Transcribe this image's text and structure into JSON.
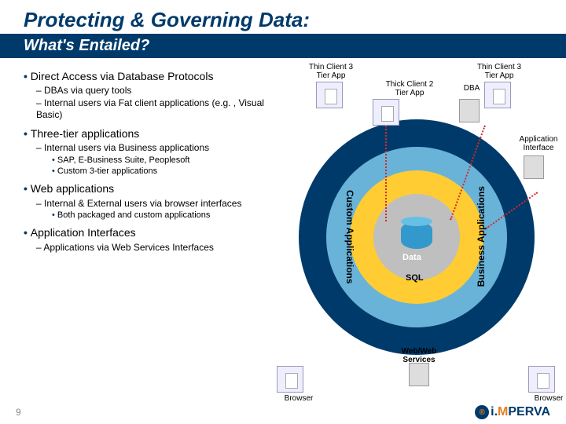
{
  "title": "Protecting & Governing Data:",
  "subtitle": "What's Entailed?",
  "bullets": {
    "b1": "Direct Access via Database Protocols",
    "b1a": "DBAs via query tools",
    "b1b": "Internal users via Fat client applications (e.g. , Visual Basic)",
    "b2": "Three-tier applications",
    "b2a": "Internal users via Business applications",
    "b2a1": "SAP, E-Business Suite, Peoplesoft",
    "b2a2": "Custom 3-tier applications",
    "b3": "Web applications",
    "b3a": "Internal & External users via browser interfaces",
    "b3a1": "Both packaged and custom applications",
    "b4": "Application Interfaces",
    "b4a": "Applications via Web Services Interfaces"
  },
  "diagram": {
    "thin_l": "Thin Client\n3 Tier App",
    "thin_r": "Thin Client\n3 Tier App",
    "thick": "Thick Client\n2 Tier App",
    "dba": "DBA",
    "appif": "Application\nInterface",
    "data": "Data",
    "sql": "SQL",
    "custom": "Custom\nApplications",
    "business": "Business\nApplications",
    "web": "Web/Web\nServices",
    "browser_l": "Browser",
    "browser_r": "Browser"
  },
  "page": "9",
  "logo": {
    "brand": "i.MPERVA"
  }
}
